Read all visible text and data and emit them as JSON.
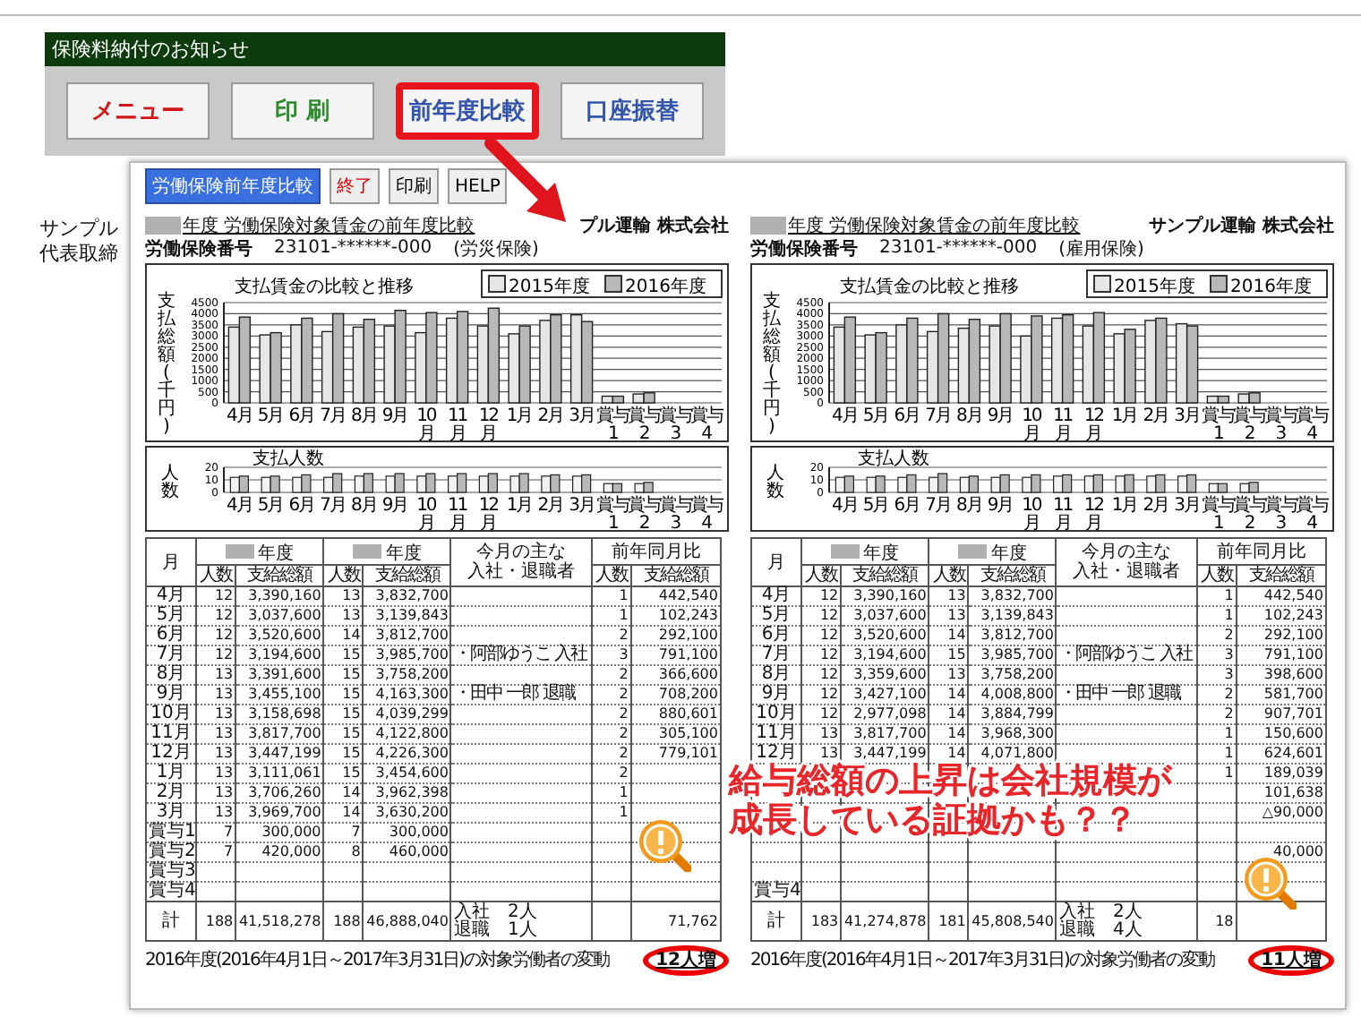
{
  "background_window": {
    "title": "保険料納付のお知らせ",
    "buttons": [
      {
        "label": "メニュー",
        "color": "#d01818",
        "highlighted": false
      },
      {
        "label": "印 刷",
        "color": "#2e8b2e",
        "highlighted": false
      },
      {
        "label": "前年度比較",
        "color": "#3355aa",
        "highlighted": true
      },
      {
        "label": "口座振替",
        "color": "#3355aa",
        "highlighted": false
      }
    ],
    "text_lines": [
      "サンプル",
      "代表取締"
    ]
  },
  "report_window": {
    "toolbar": [
      {
        "label": "労働保険前年度比較",
        "kind": "primary"
      },
      {
        "label": "終了",
        "kind": "danger"
      },
      {
        "label": "印刷",
        "kind": "plain"
      },
      {
        "label": "HELP",
        "kind": "plain"
      }
    ],
    "reports": [
      {
        "title": "年度 労働保険対象賃金の前年度比較",
        "company": "プル運輸 株式会社",
        "number_label": "労働保険番号",
        "number": "23101-******-000",
        "insurance": "(労災保険)",
        "wage_chart": {
          "chart_data": {
            "type": "bar",
            "title": "支払賃金の比較と推移",
            "ylabel": "支払総額(千円)",
            "categories": [
              "4月",
              "5月",
              "6月",
              "7月",
              "8月",
              "9月",
              "10月",
              "11月",
              "12月",
              "1月",
              "2月",
              "3月",
              "賞与1",
              "賞与2",
              "賞与3",
              "賞与4"
            ],
            "series": [
              {
                "name": "2015年度",
                "color": "#e6e6e6",
                "values": [
                  3400,
                  3050,
                  3500,
                  3200,
                  3400,
                  3450,
                  3150,
                  3800,
                  3450,
                  3100,
                  3700,
                  3950,
                  300,
                  400,
                  null,
                  null
                ]
              },
              {
                "name": "2016年度",
                "color": "#b8b8b8",
                "values": [
                  3850,
                  3150,
                  3800,
                  4000,
                  3750,
                  4150,
                  4050,
                  4100,
                  4250,
                  3450,
                  3950,
                  3650,
                  300,
                  450,
                  null,
                  null
                ]
              }
            ],
            "ylim": [
              0,
              4500
            ],
            "yticks": [
              0,
              500,
              1000,
              1500,
              2000,
              2500,
              3000,
              3500,
              4000,
              4500
            ],
            "grid": true,
            "legend": "top-right"
          }
        },
        "people_chart": {
          "chart_data": {
            "type": "bar",
            "title": "支払人数",
            "ylabel": "人数",
            "categories": [
              "4月",
              "5月",
              "6月",
              "7月",
              "8月",
              "9月",
              "10月",
              "11月",
              "12月",
              "1月",
              "2月",
              "3月",
              "賞与1",
              "賞与2",
              "賞与3",
              "賞与4"
            ],
            "series": [
              {
                "color": "#f2f2f2",
                "values": [
                  12,
                  12,
                  12,
                  12,
                  13,
                  13,
                  13,
                  13,
                  13,
                  13,
                  13,
                  13,
                  7,
                  7,
                  null,
                  null
                ]
              },
              {
                "color": "#b8b8b8",
                "values": [
                  13,
                  13,
                  14,
                  15,
                  15,
                  15,
                  15,
                  15,
                  15,
                  15,
                  14,
                  14,
                  7,
                  8,
                  null,
                  null
                ]
              }
            ],
            "ylim": [
              0,
              20
            ],
            "yticks": [
              0,
              10,
              20
            ],
            "grid": true
          }
        },
        "table": {
          "group_headers": [
            "月",
            "年度",
            "年度",
            "前年同月比"
          ],
          "note_header": [
            "今月の主な",
            "入社・退職者"
          ],
          "sub_headers": [
            "人数",
            "支給総額",
            "人数",
            "支給総額",
            "人数",
            "支給総額"
          ],
          "rows": [
            {
              "kind": "data",
              "m": "4月",
              "p1": "12",
              "a1": "3,390,160",
              "p2": "13",
              "a2": "3,832,700",
              "dp": "1",
              "da": "442,540"
            },
            {
              "kind": "data",
              "m": "5月",
              "p1": "12",
              "a1": "3,037,600",
              "p2": "13",
              "a2": "3,139,843",
              "dp": "1",
              "da": "102,243"
            },
            {
              "kind": "data",
              "m": "6月",
              "p1": "12",
              "a1": "3,520,600",
              "p2": "14",
              "a2": "3,812,700",
              "dp": "2",
              "da": "292,100"
            },
            {
              "kind": "data",
              "m": "7月",
              "p1": "12",
              "a1": "3,194,600",
              "p2": "15",
              "a2": "3,985,700",
              "note": "・阿部ゆうこ 入社",
              "dp": "3",
              "da": "791,100"
            },
            {
              "kind": "data",
              "m": "8月",
              "p1": "13",
              "a1": "3,391,600",
              "p2": "15",
              "a2": "3,758,200",
              "dp": "2",
              "da": "366,600"
            },
            {
              "kind": "data",
              "m": "9月",
              "p1": "13",
              "a1": "3,455,100",
              "p2": "15",
              "a2": "4,163,300",
              "note": "・田中 一郎 退職",
              "dp": "2",
              "da": "708,200"
            },
            {
              "kind": "data",
              "m": "10月",
              "p1": "13",
              "a1": "3,158,698",
              "p2": "15",
              "a2": "4,039,299",
              "dp": "2",
              "da": "880,601"
            },
            {
              "kind": "data",
              "m": "11月",
              "p1": "13",
              "a1": "3,817,700",
              "p2": "15",
              "a2": "4,122,800",
              "dp": "2",
              "da": "305,100"
            },
            {
              "kind": "data",
              "m": "12月",
              "p1": "13",
              "a1": "3,447,199",
              "p2": "15",
              "a2": "4,226,300",
              "dp": "2",
              "da": "779,101"
            },
            {
              "kind": "data",
              "m": "1月",
              "p1": "13",
              "a1": "3,111,061",
              "p2": "15",
              "a2": "3,454,600",
              "dp": "2"
            },
            {
              "kind": "data",
              "m": "2月",
              "p1": "13",
              "a1": "3,706,260",
              "p2": "14",
              "a2": "3,962,398",
              "dp": "1"
            },
            {
              "kind": "data",
              "m": "3月",
              "p1": "13",
              "a1": "3,969,700",
              "p2": "14",
              "a2": "3,630,200",
              "dp": "1"
            },
            {
              "kind": "data",
              "m": "賞与1",
              "p1": "7",
              "a1": "300,000",
              "p2": "7",
              "a2": "300,000"
            },
            {
              "kind": "data",
              "m": "賞与2",
              "p1": "7",
              "a1": "420,000",
              "p2": "8",
              "a2": "460,000"
            },
            {
              "kind": "data",
              "m": "賞与3"
            },
            {
              "kind": "data",
              "m": "賞与4"
            },
            {
              "kind": "total",
              "m": "計",
              "p1": "188",
              "a1": "41,518,278",
              "p2": "188",
              "a2": "46,888,040",
              "notes": [
                "入社　2人",
                "退職　1人"
              ],
              "da": "71,762"
            }
          ]
        },
        "footer": "2016年度(2016年4月1日～2017年3月31日)の対象労働者の変動",
        "change": "12人増"
      },
      {
        "title": "年度 労働保険対象賃金の前年度比較",
        "company": "サンプル運輸 株式会社",
        "number_label": "労働保険番号",
        "number": "23101-******-000",
        "insurance": "(雇用保険)",
        "wage_chart": {
          "chart_data": {
            "type": "bar",
            "title": "支払賃金の比較と推移",
            "ylabel": "支払総額(千円)",
            "categories": [
              "4月",
              "5月",
              "6月",
              "7月",
              "8月",
              "9月",
              "10月",
              "11月",
              "12月",
              "1月",
              "2月",
              "3月",
              "賞与1",
              "賞与2",
              "賞与3",
              "賞与4"
            ],
            "series": [
              {
                "name": "2015年度",
                "color": "#e6e6e6",
                "values": [
                  3400,
                  3050,
                  3500,
                  3200,
                  3350,
                  3450,
                  3000,
                  3800,
                  3450,
                  3100,
                  3700,
                  3550,
                  300,
                  400,
                  null,
                  null
                ]
              },
              {
                "name": "2016年度",
                "color": "#b8b8b8",
                "values": [
                  3850,
                  3150,
                  3800,
                  4000,
                  3750,
                  4000,
                  3900,
                  3950,
                  4050,
                  3300,
                  3800,
                  3450,
                  300,
                  450,
                  null,
                  null
                ]
              }
            ],
            "ylim": [
              0,
              4500
            ],
            "yticks": [
              0,
              500,
              1000,
              1500,
              2000,
              2500,
              3000,
              3500,
              4000,
              4500
            ],
            "grid": true,
            "legend": "top-right"
          }
        },
        "people_chart": {
          "chart_data": {
            "type": "bar",
            "title": "支払人数",
            "ylabel": "人数",
            "categories": [
              "4月",
              "5月",
              "6月",
              "7月",
              "8月",
              "9月",
              "10月",
              "11月",
              "12月",
              "1月",
              "2月",
              "3月",
              "賞与1",
              "賞与2",
              "賞与3",
              "賞与4"
            ],
            "series": [
              {
                "color": "#f2f2f2",
                "values": [
                  12,
                  12,
                  12,
                  12,
                  12,
                  12,
                  12,
                  13,
                  13,
                  13,
                  13,
                  13,
                  7,
                  7,
                  null,
                  null
                ]
              },
              {
                "color": "#b8b8b8",
                "values": [
                  13,
                  13,
                  14,
                  15,
                  13,
                  14,
                  14,
                  14,
                  14,
                  14,
                  14,
                  14,
                  7,
                  8,
                  null,
                  null
                ]
              }
            ],
            "ylim": [
              0,
              20
            ],
            "yticks": [
              0,
              10,
              20
            ],
            "grid": true
          }
        },
        "table": {
          "group_headers": [
            "月",
            "年度",
            "年度",
            "前年同月比"
          ],
          "note_header": [
            "今月の主な",
            "入社・退職者"
          ],
          "sub_headers": [
            "人数",
            "支給総額",
            "人数",
            "支給総額",
            "人数",
            "支給総額"
          ],
          "rows": [
            {
              "kind": "data",
              "m": "4月",
              "p1": "12",
              "a1": "3,390,160",
              "p2": "13",
              "a2": "3,832,700",
              "dp": "1",
              "da": "442,540"
            },
            {
              "kind": "data",
              "m": "5月",
              "p1": "12",
              "a1": "3,037,600",
              "p2": "13",
              "a2": "3,139,843",
              "dp": "1",
              "da": "102,243"
            },
            {
              "kind": "data",
              "m": "6月",
              "p1": "12",
              "a1": "3,520,600",
              "p2": "14",
              "a2": "3,812,700",
              "dp": "2",
              "da": "292,100"
            },
            {
              "kind": "data",
              "m": "7月",
              "p1": "12",
              "a1": "3,194,600",
              "p2": "15",
              "a2": "3,985,700",
              "note": "・阿部ゆうこ 入社",
              "dp": "3",
              "da": "791,100"
            },
            {
              "kind": "data",
              "m": "8月",
              "p1": "12",
              "a1": "3,359,600",
              "p2": "13",
              "a2": "3,758,200",
              "dp": "3",
              "da": "398,600"
            },
            {
              "kind": "data",
              "m": "9月",
              "p1": "12",
              "a1": "3,427,100",
              "p2": "14",
              "a2": "4,008,800",
              "note": "・田中 一郎 退職",
              "dp": "2",
              "da": "581,700"
            },
            {
              "kind": "data",
              "m": "10月",
              "p1": "12",
              "a1": "2,977,098",
              "p2": "14",
              "a2": "3,884,799",
              "dp": "2",
              "da": "907,701"
            },
            {
              "kind": "data",
              "m": "11月",
              "p1": "13",
              "a1": "3,817,700",
              "p2": "14",
              "a2": "3,968,300",
              "dp": "1",
              "da": "150,600"
            },
            {
              "kind": "data",
              "m": "12月",
              "p1": "13",
              "a1": "3,447,199",
              "p2": "14",
              "a2": "4,071,800",
              "dp": "1",
              "da": "624,601"
            },
            {
              "kind": "data",
              "dp": "1",
              "da": "189,039"
            },
            {
              "kind": "data",
              "da": "101,638"
            },
            {
              "kind": "data",
              "da": "△90,000"
            },
            {
              "kind": "data"
            },
            {
              "kind": "data",
              "da": "40,000"
            },
            {
              "kind": "data"
            },
            {
              "kind": "data",
              "m": "賞与4"
            },
            {
              "kind": "total",
              "m": "計",
              "p1": "183",
              "a1": "41,274,878",
              "p2": "181",
              "a2": "45,808,540",
              "notes": [
                "入社　2人",
                "退職　4人"
              ],
              "dp": "18"
            }
          ]
        },
        "footer": "2016年度(2016年4月1日～2017年3月31日)の対象労働者の変動",
        "change": "11人増"
      }
    ]
  },
  "callout": "給与総額の上昇は会社規模が成長している証拠かも？？"
}
